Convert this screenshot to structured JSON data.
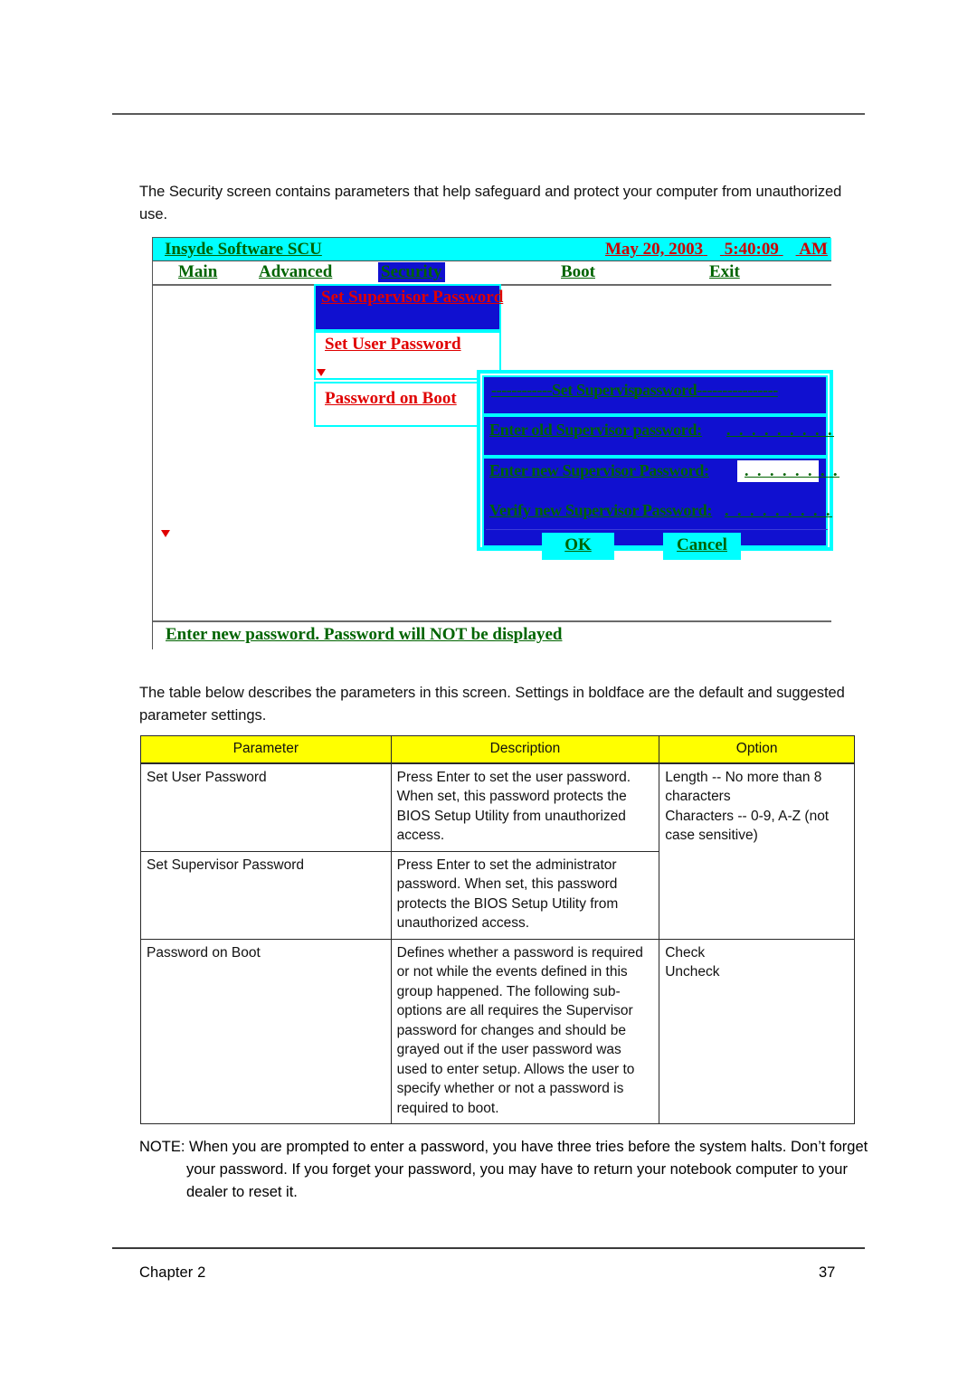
{
  "page": {
    "intro_paragraph": "The Security screen contains parameters that help safeguard and protect your computer from unauthorized use.",
    "table_intro_paragraph": "The table below describes the parameters in this screen. Settings in boldface  are the default and suggested parameter settings.",
    "note_label": "NOTE:",
    "note_text": "When you are prompted to enter a password, you have three tries before the system halts. Don’t forget your password. If you forget your password, you may have to return your notebook computer to your dealer to reset it.",
    "footer_chapter": "Chapter 2",
    "footer_page": "37"
  },
  "bios": {
    "title": "Insyde Software SCU",
    "date": "May 20, 2003",
    "time": "5:40:09",
    "meridiem": "AM",
    "menu": [
      {
        "label": "Main",
        "active": false
      },
      {
        "label": "Advanced",
        "active": false
      },
      {
        "label": "Security",
        "active": true
      },
      {
        "label": "Boot",
        "active": false
      },
      {
        "label": "Exit",
        "active": false
      }
    ],
    "options": [
      {
        "label": "Set Supervisor Password",
        "selected": true
      },
      {
        "label": "Set User Password",
        "selected": false
      },
      {
        "label": "Password on Boot",
        "selected": false
      }
    ],
    "status_text": "Enter new password. Password will NOT be displayed",
    "dialog": {
      "title_lead": "------------",
      "title_main": "Set Superviso",
      "title_overlap": "password",
      "title_trail": "----------------",
      "old_label": "Enter old Supervisor password:",
      "old_value": ". . . . . . . . .",
      "new_label": "Enter new Supervisor Password:",
      "new_value": ". . . . . . . .",
      "new_value_tail": ". .",
      "verify_label": "Verify new Supervisor Password:",
      "verify_value": ". . . . . . . . .",
      "ok_label": "OK",
      "cancel_label": "Cancel"
    },
    "colors": {
      "titlebar": "#00ffff",
      "title_text": "#006400",
      "datetime_text": "#cc0000",
      "menu_text": "#006400",
      "menu_active_bg": "#1010d0",
      "option_text": "#e00000",
      "option_selected_bg": "#1010d0",
      "dialog_bg": "#1010d0",
      "dialog_border": "#00ffff",
      "dialog_text": "#006400",
      "button_bg": "#00ffff"
    }
  },
  "table": {
    "headers": [
      "Parameter",
      "Description",
      "Option"
    ],
    "header_bg": "#ffff00",
    "rows": [
      {
        "parameter": "Set User Password",
        "description": "Press Enter to set the user password. When set, this password protects the BIOS Setup Utility from unauthorized access.",
        "option": "Length -- No more than 8 characters\nCharacters -- 0-9, A-Z (not case sensitive)"
      },
      {
        "parameter": "Set Supervisor Password",
        "description": "Press Enter to set the administrator password. When set, this password protects the BIOS Setup Utility from unauthorized access.",
        "option": ""
      },
      {
        "parameter": "Password on Boot",
        "description": "Defines whether a password is required or not while the events defined in this group happened. The following sub-options are all requires the Supervisor password for changes and should be grayed out if the user password was used to enter setup. Allows the user to specify whether or not a password is required to boot.",
        "option": "Check\nUncheck"
      }
    ]
  }
}
